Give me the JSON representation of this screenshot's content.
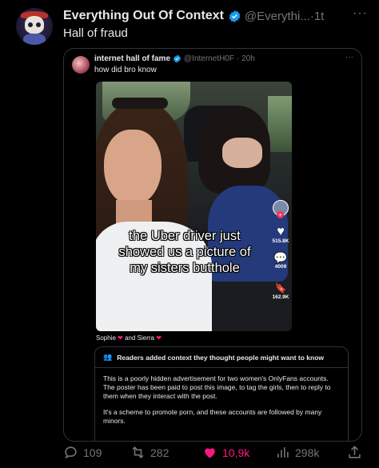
{
  "tweet": {
    "author_name": "Everything Out Of Context",
    "handle": "@Everythi...",
    "time": "1t",
    "separator": "·",
    "more": "···",
    "text": "Hall of fraud"
  },
  "quoted": {
    "author_name": "internet hall of fame",
    "handle": "@InternetH0F",
    "time": "· 20h",
    "more": "···",
    "text": "how did bro know",
    "caption_lines": [
      "the Uber driver just",
      "showed us a picture of",
      "my sisters butthole"
    ],
    "side_counts": {
      "likes": "515.8K",
      "comments": "4009",
      "saves": "162.9K"
    },
    "tags": {
      "name1": "Sophie",
      "and": "and Sierra"
    }
  },
  "note": {
    "title": "Readers added context they thought people might want to know",
    "paragraphs": [
      "This is a poorly hidden advertisement for two women's OnlyFans accounts. The poster has been paid to post this image, to tag the girls, then to reply to them when they interact with the post.",
      "It's a scheme to promote porn, and these accounts are followed by many minors."
    ]
  },
  "actions": {
    "replies": "109",
    "reposts": "282",
    "likes": "10,9k",
    "views": "298k"
  },
  "colors": {
    "accent": "#1d9bf0",
    "like": "#f91880",
    "muted": "#71767b"
  }
}
